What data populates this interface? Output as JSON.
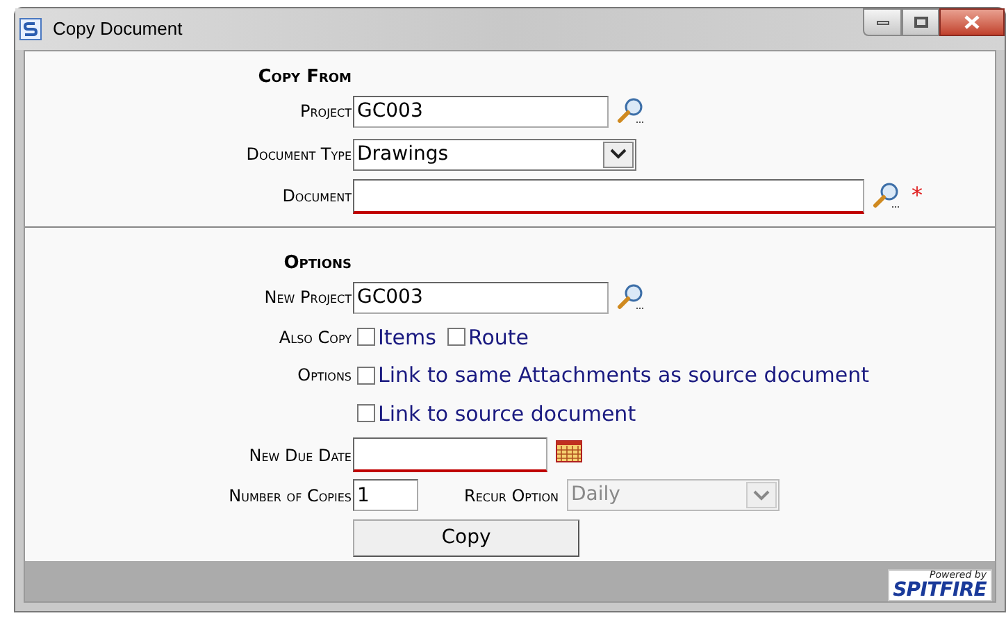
{
  "window": {
    "title": "Copy Document"
  },
  "copy_from": {
    "heading": "Copy From",
    "project": {
      "label": "Project",
      "value": "GC003"
    },
    "document_type": {
      "label": "Document Type",
      "value": "Drawings"
    },
    "document": {
      "label": "Document",
      "required": true,
      "required_mark": "*"
    }
  },
  "options": {
    "heading": "Options",
    "new_project": {
      "label": "New Project",
      "value": "GC003"
    },
    "also_copy": {
      "label": "Also Copy",
      "checkboxes": [
        {
          "label": "Items",
          "checked": false
        },
        {
          "label": "Route",
          "checked": false
        }
      ]
    },
    "link_options": {
      "label": "Options",
      "checkboxes": [
        {
          "label": "Link to same Attachments as source document",
          "checked": false
        },
        {
          "label": "Link to source document",
          "checked": false
        }
      ]
    },
    "new_due_date": {
      "label": "New Due Date",
      "required": true
    },
    "number_of_copies": {
      "label": "Number of Copies",
      "value": "1"
    },
    "recur_option": {
      "label": "Recur Option",
      "value": "Daily",
      "disabled": true
    }
  },
  "copy_button": "Copy",
  "footer": {
    "logo_small": "Powered by",
    "logo_big": "SPITFIRE"
  }
}
